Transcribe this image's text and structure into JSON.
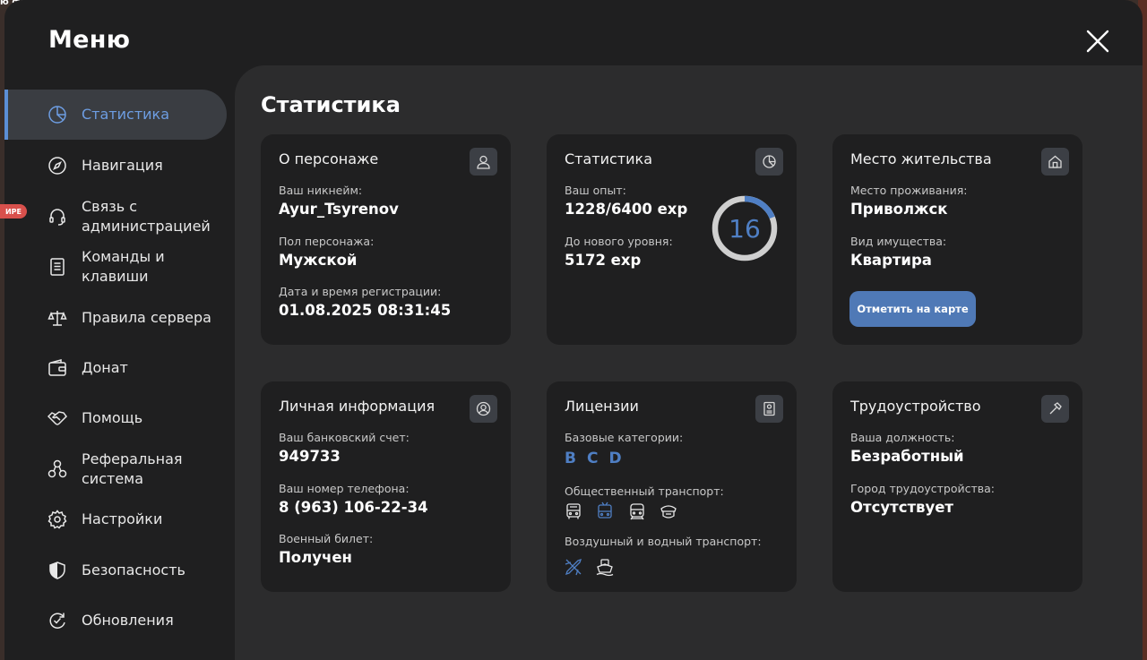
{
  "background": {
    "top_text": "ю французски",
    "badge": "ИРЕ"
  },
  "window": {
    "title": "Меню"
  },
  "sidebar": {
    "items": [
      {
        "label": "Статистика",
        "icon": "pie-chart-icon",
        "active": true
      },
      {
        "label": "Навигация",
        "icon": "compass-icon"
      },
      {
        "label": "Связь с администрацией",
        "icon": "headset-icon"
      },
      {
        "label": "Команды и клавиши",
        "icon": "document-icon"
      },
      {
        "label": "Правила сервера",
        "icon": "scales-icon"
      },
      {
        "label": "Донат",
        "icon": "wallet-icon"
      },
      {
        "label": "Помощь",
        "icon": "handshake-icon"
      },
      {
        "label": "Реферальная система",
        "icon": "network-icon"
      },
      {
        "label": "Настройки",
        "icon": "gear-icon"
      },
      {
        "label": "Безопасность",
        "icon": "shield-icon"
      },
      {
        "label": "Обновления",
        "icon": "refresh-icon"
      }
    ]
  },
  "main": {
    "title": "Статистика",
    "character": {
      "title": "О персонаже",
      "icon": "user-icon",
      "nickname_label": "Ваш никнейм:",
      "nickname": "Ayur_Tsyrenov",
      "gender_label": "Пол персонажа:",
      "gender": "Мужской",
      "reg_label": "Дата и время регистрации:",
      "reg_date": "01.08.2025 08:31:45"
    },
    "stats": {
      "title": "Статистика",
      "icon": "pie-chart-icon",
      "exp_label": "Ваш опыт:",
      "exp": "1228/6400 exp",
      "next_label": "До нового уровня:",
      "next": "5172 exp",
      "level": "16",
      "progress": 0.19,
      "ring_color": "#4f7fc4",
      "ring_track": "#cfcfcf"
    },
    "residence": {
      "title": "Место жительства",
      "icon": "house-icon",
      "place_label": "Место проживания:",
      "place": "Приволжск",
      "property_label": "Вид имущества:",
      "property": "Квартира",
      "button": "Отметить на карте"
    },
    "personal": {
      "title": "Личная информация",
      "icon": "user-circle-icon",
      "bank_label": "Ваш банковский счет:",
      "bank": "949733",
      "phone_label": "Ваш номер телефона:",
      "phone": "8 (963) 106-22-34",
      "military_label": "Военный билет:",
      "military": "Получен"
    },
    "licenses": {
      "title": "Лицензии",
      "icon": "id-card-icon",
      "basic_label": "Базовые категории:",
      "categories": [
        "B",
        "C",
        "D"
      ],
      "public_label": "Общественный транспорт:",
      "public_icons": [
        "bus-icon",
        "trolleybus-icon",
        "tram-icon",
        "taxi-icon"
      ],
      "air_label": "Воздушный и водный транспорт:",
      "air_icons": [
        "plane-icon",
        "ship-icon"
      ]
    },
    "employment": {
      "title": "Трудоустройство",
      "icon": "hammer-icon",
      "position_label": "Ваша должность:",
      "position": "Безработный",
      "city_label": "Город трудоустройства:",
      "city": "Отсутствует"
    }
  },
  "colors": {
    "accent": "#5b8ed6",
    "button": "#4f79b6",
    "window_bg": "#1f1f20",
    "content_bg": "#2c2c2d"
  }
}
